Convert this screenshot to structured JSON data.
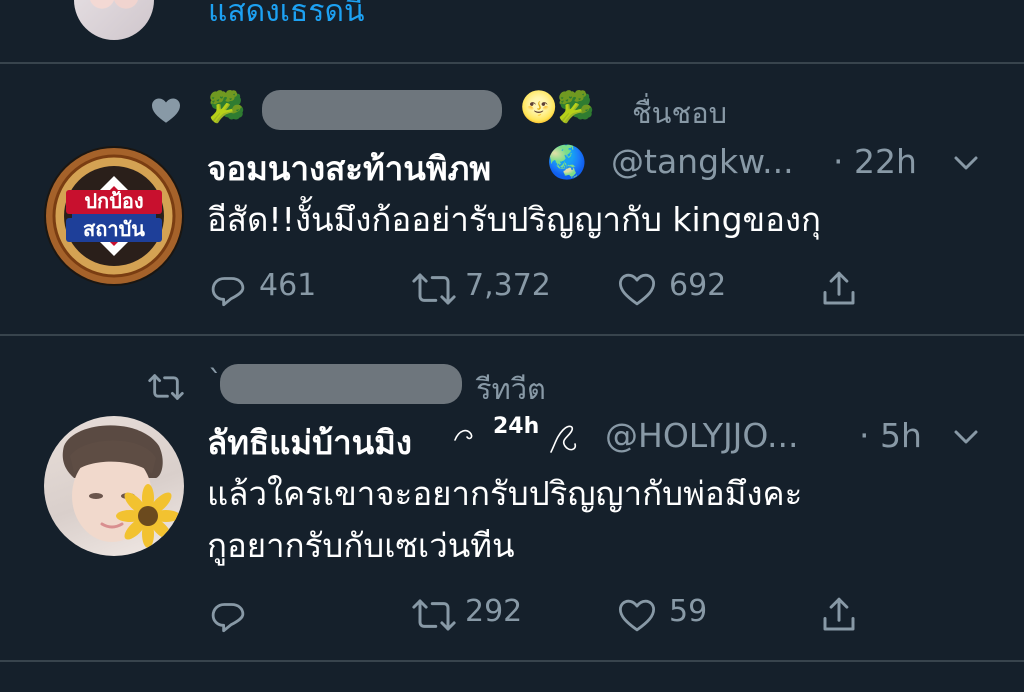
{
  "top_tweet": {
    "link_text": "แสดงเธรดนี้"
  },
  "tweet1": {
    "social_context": "ชื่นชอบ",
    "context_emoji_left": "🥦",
    "context_emoji_right": "🌝🥦",
    "display_name": "จอมนางสะท้านพิภพ",
    "name_emoji": "🌏",
    "handle": "@tangkw...",
    "time": "· 22h",
    "text": "อีสัด!!งั้นมึงก้ออย่ารับปริญญากับ kingของกุ",
    "avatar_text_line1": "ปกป้อง",
    "avatar_text_line2": "สถาบัน",
    "reply_count": "461",
    "retweet_count": "7,372",
    "like_count": "692"
  },
  "tweet2": {
    "social_context": "รีทวีต",
    "context_prefix": "`",
    "display_name": "ลัทธิแม่บ้านมิง",
    "name_decoration": "24h",
    "handle": "@HOLYJJO...",
    "time": "· 5h",
    "text_line1": "แล้วใครเขาจะอยากรับปริญญากับพ่อมึงคะ",
    "text_line2": "กูอยากรับกับเซเว่นทีน",
    "reply_count": "",
    "retweet_count": "292",
    "like_count": "59"
  },
  "colors": {
    "background": "#15202b",
    "divider": "#38444d",
    "secondary_text": "#8899a6",
    "link": "#1da1f2"
  }
}
